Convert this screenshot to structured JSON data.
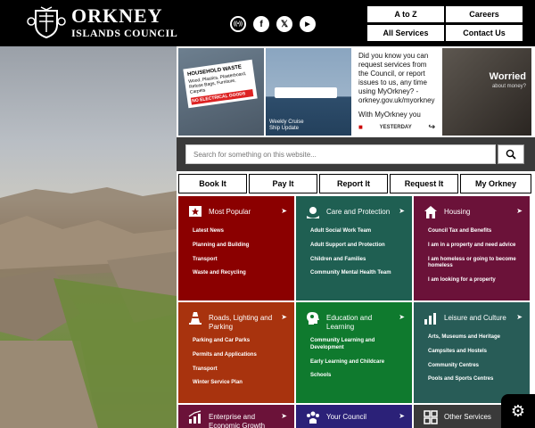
{
  "header": {
    "logo_line1": "ORKNEY",
    "logo_line2": "ISLANDS COUNCIL",
    "social": [
      {
        "icon": "broadcast-icon",
        "label": "((•))"
      },
      {
        "icon": "facebook-icon",
        "label": "f"
      },
      {
        "icon": "x-icon",
        "label": "𝕏"
      },
      {
        "icon": "youtube-icon",
        "label": "▶"
      }
    ],
    "buttons": {
      "a_to_z": "A to Z",
      "careers": "Careers",
      "all_services": "All Services",
      "contact_us": "Contact Us"
    }
  },
  "social_strip": {
    "tile1_sign_line1": "HOUSEHOLD WASTE",
    "tile1_sign_line2": "Wood, Plastics, Plasterboard, Refuse Bags, Furniture, Carpets",
    "tile1_sign_red": "NO ELECTRICAL GOODS",
    "tile2_caption_line1": "Weekly Cruise",
    "tile2_caption_line2": "Ship Update",
    "tile3_text": "Did you know you can request services from the Council, or report issues to us, any time using MyOrkney? - orkney.gov.uk/myorkney",
    "tile3_text2": "With MyOrkney you",
    "tile3_time": "YESTERDAY",
    "tile4_word": "Worried",
    "tile4_sub": "about money?"
  },
  "search": {
    "placeholder": "Search for something on this website..."
  },
  "quick_links": [
    "Book It",
    "Pay It",
    "Report It",
    "Request It",
    "My Orkney"
  ],
  "cards": [
    {
      "title": "Most Popular",
      "icon": "star-icon",
      "color": "#8b0000",
      "links": [
        "Latest News",
        "Planning and Building",
        "Transport",
        "Waste and Recycling"
      ]
    },
    {
      "title": "Care and Protection",
      "icon": "care-hands-icon",
      "color": "#1f5f52",
      "links": [
        "Adult Social Work Team",
        "Adult Support and Protection",
        "Children and Families",
        "Community Mental Health Team"
      ]
    },
    {
      "title": "Housing",
      "icon": "house-icon",
      "color": "#6b1239",
      "links": [
        "Council Tax and Benefits",
        "I am in a property and need advice",
        "I am homeless or going to become homeless",
        "I am looking for a property"
      ]
    },
    {
      "title": "Roads, Lighting and Parking",
      "icon": "traffic-cone-icon",
      "color": "#a8330e",
      "links": [
        "Parking and Car Parks",
        "Permits and Applications",
        "Transport",
        "Winter Service Plan"
      ]
    },
    {
      "title": "Education and Learning",
      "icon": "education-head-icon",
      "color": "#0f7a2e",
      "links": [
        "Community Learning and Development",
        "Early Learning and Childcare",
        "Schools"
      ]
    },
    {
      "title": "Leisure and Culture",
      "icon": "leisure-chart-icon",
      "color": "#285c57",
      "links": [
        "Arts, Museums and Heritage",
        "Campsites and Hostels",
        "Community Centres",
        "Pools and Sports Centres"
      ]
    },
    {
      "title": "Enterprise and Economic Growth",
      "icon": "growth-chart-icon",
      "color": "#6b1239",
      "links": []
    },
    {
      "title": "Your Council",
      "icon": "people-icon",
      "color": "#2b2178",
      "links": []
    },
    {
      "title": "Other Services",
      "icon": "grid-icon",
      "color": "#3a3a3a",
      "links": []
    }
  ]
}
